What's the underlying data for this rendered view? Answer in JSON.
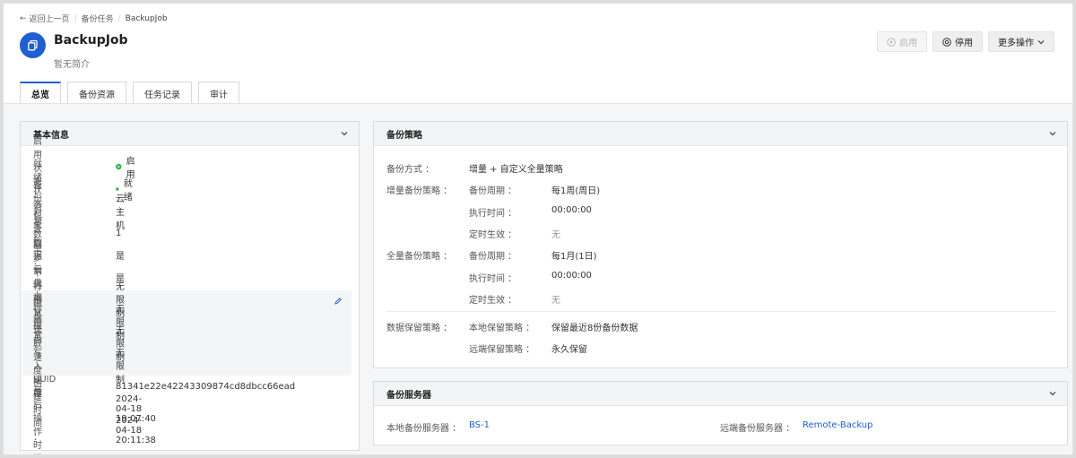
{
  "breadcrumb": {
    "back": "返回上一页",
    "parent": "备份任务",
    "current": "BackupJob"
  },
  "job": {
    "title": "BackupJob",
    "description": "暂无简介"
  },
  "actions": {
    "enable": "启用",
    "disable": "停用",
    "more": "更多操作"
  },
  "tabs": [
    "总览",
    "备份资源",
    "任务记录",
    "审计"
  ],
  "basic_info": {
    "title": "基本信息",
    "rows": [
      {
        "key": "启用状态 ：",
        "value": "启用"
      },
      {
        "key": "就绪状态 ：",
        "value": "就绪"
      },
      {
        "key": "备份对象 ：",
        "value": "云主机"
      },
      {
        "key": "资源数量 ：",
        "value": "1"
      },
      {
        "key": "包含数据云盘 ：",
        "value": "是"
      },
      {
        "key": "同步到远端 ：",
        "value": "是"
      },
      {
        "key": "下行带宽 ：",
        "value": "无限制"
      },
      {
        "key": "上行带宽 ：",
        "value": "无限制"
      },
      {
        "key": "磁盘读取速度 ：",
        "value": "无限制"
      },
      {
        "key": "磁盘写入速度 ：",
        "value": "无限制"
      },
      {
        "key": "UUID ：",
        "value": "81341e22e42243309874cd8dbcc66ead"
      },
      {
        "key": "创建时间 ：",
        "value": "2024-04-18 19:07:40"
      },
      {
        "key": "最后操作时间 ：",
        "value": "2024-04-18 20:11:38"
      }
    ]
  },
  "strategy": {
    "title": "备份策略",
    "method_key": "备份方式 ：",
    "method_value": "增量 + 自定义全量策略",
    "incremental": {
      "key": "增量备份策略 ：",
      "period_key": "备份周期 ：",
      "period_value": "每1周(周日)",
      "time_key": "执行时间 ：",
      "time_value": "00:00:00",
      "effect_key": "定时生效 ：",
      "effect_value": "无"
    },
    "full": {
      "key": "全量备份策略 ：",
      "period_key": "备份周期 ：",
      "period_value": "每1月(1日)",
      "time_key": "执行时间 ：",
      "time_value": "00:00:00",
      "effect_key": "定时生效 ：",
      "effect_value": "无"
    },
    "retention": {
      "key": "数据保留策略 ：",
      "local_key": "本地保留策略 ：",
      "local_value": "保留最近8份备份数据",
      "remote_key": "远端保留策略 ：",
      "remote_value": "永久保留"
    }
  },
  "servers": {
    "title": "备份服务器",
    "local_key": "本地备份服务器 ：",
    "local_value": "BS-1",
    "remote_key": "远端备份服务器 ：",
    "remote_value": "Remote-Backup"
  },
  "colors": {
    "accent": "#1f5fd0",
    "enabled": "#2eb84a",
    "ready": "#2eb84a"
  }
}
